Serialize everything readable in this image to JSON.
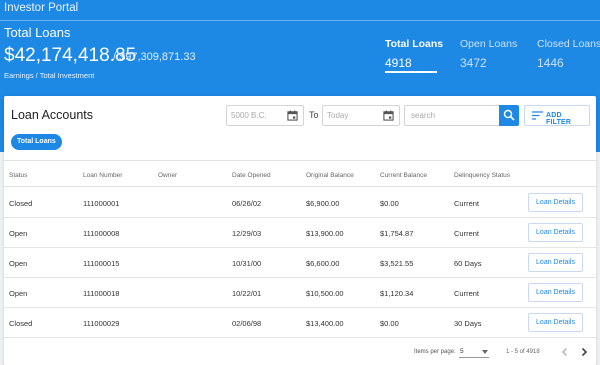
{
  "app": {
    "title": "Investor Portal"
  },
  "summary": {
    "label": "Total Loans",
    "earnings": "$42,174,418.85",
    "investment": "/ $97,309,871.33",
    "caption": "Earnings / Total Investment"
  },
  "stats": [
    {
      "label": "Total Loans",
      "value": "4918",
      "active": true
    },
    {
      "label": "Open Loans",
      "value": "3472",
      "active": false
    },
    {
      "label": "Closed Loans",
      "value": "1446",
      "active": false
    }
  ],
  "card": {
    "title": "Loan Accounts",
    "from_date_placeholder": "5000 B.C.",
    "to_label": "To",
    "to_date_placeholder": "Today",
    "search_placeholder": "search",
    "filter_label": "ADD FILTER",
    "chip": "Total Loans"
  },
  "table": {
    "columns": [
      "Status",
      "Loan Number",
      "Owner",
      "Date Opened",
      "Original Balance",
      "Current Balance",
      "Delinquency Status"
    ],
    "action_label": "Loan Details",
    "rows": [
      {
        "status": "Closed",
        "loan_number": "111000001",
        "owner": "",
        "date_opened": "06/26/02",
        "original_balance": "$6,900.00",
        "current_balance": "$0.00",
        "delinquency": "Current"
      },
      {
        "status": "Open",
        "loan_number": "111000008",
        "owner": "",
        "date_opened": "12/29/03",
        "original_balance": "$13,900.00",
        "current_balance": "$1,754.87",
        "delinquency": "Current"
      },
      {
        "status": "Open",
        "loan_number": "111000015",
        "owner": "",
        "date_opened": "10/31/00",
        "original_balance": "$6,600.00",
        "current_balance": "$3,521.55",
        "delinquency": "60 Days"
      },
      {
        "status": "Open",
        "loan_number": "111000018",
        "owner": "",
        "date_opened": "10/22/01",
        "original_balance": "$10,500.00",
        "current_balance": "$1,120.34",
        "delinquency": "Current"
      },
      {
        "status": "Closed",
        "loan_number": "111000029",
        "owner": "",
        "date_opened": "02/06/98",
        "original_balance": "$13,400.00",
        "current_balance": "$0.00",
        "delinquency": "30 Days"
      }
    ]
  },
  "pagination": {
    "items_per_page_label": "Items per page:",
    "items_per_page": "5",
    "range": "1 - 5 of 4918"
  },
  "colors": {
    "primary": "#1e88e5",
    "background": "#eef1f4"
  },
  "icons": [
    "calendar-icon",
    "search-icon",
    "filter-icon",
    "chevron-left-icon",
    "chevron-right-icon",
    "dropdown-arrow-icon"
  ]
}
